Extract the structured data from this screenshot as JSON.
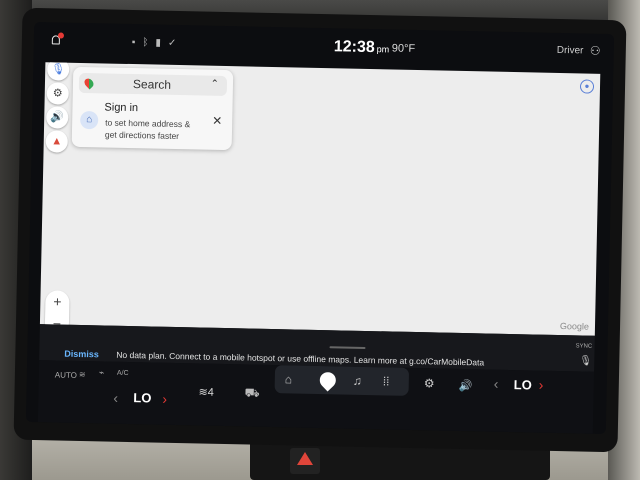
{
  "status": {
    "time": "12:38",
    "time_suffix": "pm",
    "outside_temp": "90°F",
    "profile_label": "Driver"
  },
  "search_card": {
    "search_label": "Search",
    "signin_title": "Sign in",
    "signin_sub_line1": "to set home address &",
    "signin_sub_line2": "get directions faster"
  },
  "map": {
    "google_logo": "Google"
  },
  "zoom": {
    "in_label": "+",
    "out_label": "−"
  },
  "data_notice": {
    "dismiss_label": "Dismiss",
    "message": "No data plan. Connect to a mobile hotspot or use offline maps. Learn more at g.co/CarMobileData"
  },
  "climate": {
    "auto_label": "AUTO",
    "ac_label": "A/C",
    "left_temp": "LO",
    "right_temp": "LO",
    "seat_level": "4",
    "sync_label": "SYNC"
  },
  "icons": {
    "notifications": "bell-icon",
    "mic": "microphone-icon",
    "settings": "gear-icon",
    "sound": "speaker-icon",
    "compass": "compass-icon",
    "home_shortcut": "home-icon",
    "close": "close-icon",
    "account": "account-icon",
    "dock_home": "home-icon",
    "dock_nav": "navigation-pin-icon",
    "dock_music": "music-note-icon",
    "dock_apps": "apps-grid-icon",
    "car": "car-icon",
    "volume": "volume-icon",
    "voice": "microphone-icon"
  },
  "colors": {
    "accent_blue": "#6ab7ff",
    "alert_red": "#e53935",
    "map_bg": "#ededed"
  }
}
